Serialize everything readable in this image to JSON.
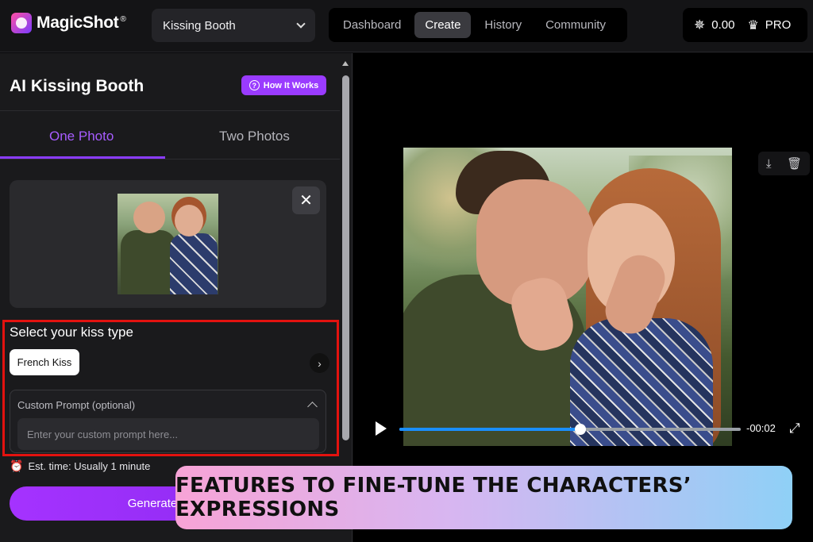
{
  "app": {
    "name": "MagicShot",
    "trademark": "®"
  },
  "tool_select": {
    "value": "Kissing Booth"
  },
  "nav": {
    "items": [
      {
        "label": "Dashboard"
      },
      {
        "label": "Create"
      },
      {
        "label": "History"
      },
      {
        "label": "Community"
      }
    ],
    "active": "Create"
  },
  "account": {
    "credits": "0.00",
    "plan": "PRO"
  },
  "panel": {
    "title": "AI Kissing Booth",
    "how_it_works": "How It Works",
    "tabs": [
      {
        "label": "One Photo"
      },
      {
        "label": "Two Photos"
      }
    ],
    "active_tab": "One Photo",
    "kiss_type_label": "Select your kiss type",
    "kiss_type_selected": "French Kiss",
    "custom_prompt": {
      "title": "Custom Prompt (optional)",
      "placeholder": "Enter your custom prompt here...",
      "value": ""
    },
    "estimate": "Est. time: Usually 1 minute",
    "generate_label": "Generate"
  },
  "player": {
    "time": "-00:02",
    "progress": 0.53
  },
  "banner": {
    "text": "FEATURES TO FINE-TUNE THE CHARACTERS’ EXPRESSIONS"
  },
  "colors": {
    "accent": "#9a3bff",
    "highlight": "#e3120f",
    "progress": "#1a8fff"
  }
}
